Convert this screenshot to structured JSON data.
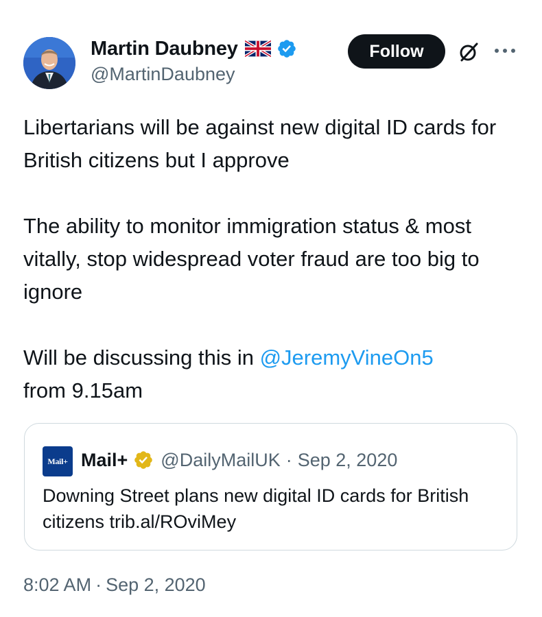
{
  "author": {
    "display_name": "Martin Daubney",
    "handle": "@MartinDaubney",
    "flag_icon": "uk-flag-icon",
    "verified_icon": "verified-badge-icon",
    "verified_color": "#1d9bf0"
  },
  "actions": {
    "follow_label": "Follow",
    "grok_icon": "grok-icon",
    "more_icon": "more-options-icon"
  },
  "tweet": {
    "paragraph_1": "Libertarians will be against new digital ID cards for British citizens but I approve",
    "paragraph_2": "The ability to monitor immigration status & most vitally, stop widespread voter fraud are too big to ignore",
    "paragraph_3_prefix": "Will be discussing this in ",
    "paragraph_3_mention": "@JeremyVineOn5",
    "paragraph_3_suffix": "from 9.15am"
  },
  "quoted_tweet": {
    "logo_text": "Mail+",
    "display_name": "Mail+",
    "verified_icon": "gold-verified-badge-icon",
    "verified_color": "#e2b719",
    "handle": "@DailyMailUK",
    "separator": "·",
    "date": "Sep 2, 2020",
    "text": "Downing Street plans new digital ID cards for British citizens trib.al/ROviMey"
  },
  "meta": {
    "time": "8:02 AM",
    "separator": "·",
    "date": "Sep 2, 2020"
  },
  "colors": {
    "link": "#1d9bf0",
    "secondary_text": "#536471",
    "primary_text": "#0f1419",
    "border": "#cfd9de"
  }
}
